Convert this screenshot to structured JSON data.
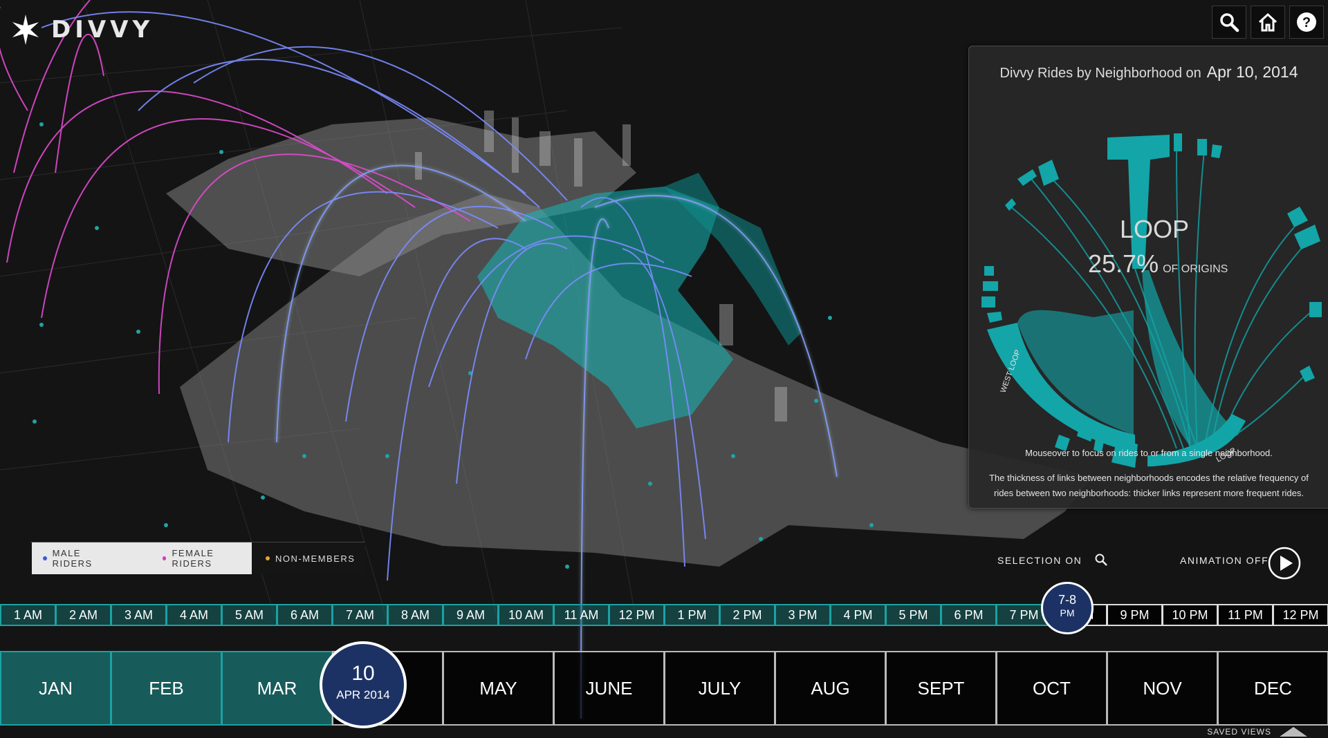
{
  "app": {
    "logo_text": "DIVVY"
  },
  "toolbar": {
    "search_icon": "search-icon",
    "home_icon": "home-icon",
    "help_icon": "help-icon"
  },
  "panel": {
    "title": "Divvy Rides by Neighborhood on",
    "date": "Apr 10, 2014",
    "focus_name": "LOOP",
    "focus_pct": "25.7%",
    "focus_suffix": "OF ORIGINS",
    "arc_label_west": "WEST LOOP",
    "arc_label_loop": "LOOP",
    "note1": "Mouseover to focus on rides to or from a single neighborhood.",
    "note2": "The thickness of links between neighborhoods encodes the relative frequency of rides between two neighborhoods: thicker links represent more frequent rides."
  },
  "legend": {
    "items": [
      {
        "label": "MALE RIDERS",
        "color": "#3a5bd9"
      },
      {
        "label": "FEMALE RIDERS",
        "color": "#d63cc0"
      },
      {
        "label": "NON-MEMBERS",
        "color": "#e8a33c"
      }
    ]
  },
  "controls": {
    "selection_label": "SELECTION ON",
    "animation_label": "ANIMATION OFF"
  },
  "hours": {
    "items": [
      "1 AM",
      "2 AM",
      "3 AM",
      "4 AM",
      "5 AM",
      "6 AM",
      "7 AM",
      "8 AM",
      "9 AM",
      "10 AM",
      "11 AM",
      "12 PM",
      "1 PM",
      "2 PM",
      "3 PM",
      "4 PM",
      "5 PM",
      "6 PM",
      "7 PM",
      "8 PM",
      "9 PM",
      "10 PM",
      "11 PM",
      "12 PM"
    ],
    "selected_range": "7-8",
    "selected_period": "PM"
  },
  "months": {
    "items": [
      "JAN",
      "FEB",
      "MAR",
      "APR",
      "MAY",
      "JUNE",
      "JULY",
      "AUG",
      "SEPT",
      "OCT",
      "NOV",
      "DEC"
    ],
    "selected_day": "10",
    "selected_month_year": "APR 2014"
  },
  "footer": {
    "saved_views": "SAVED VIEWS"
  },
  "colors": {
    "accent": "#1aa3a3",
    "badge": "#1d3264",
    "male": "#7c8cff",
    "female": "#e04bd0"
  }
}
